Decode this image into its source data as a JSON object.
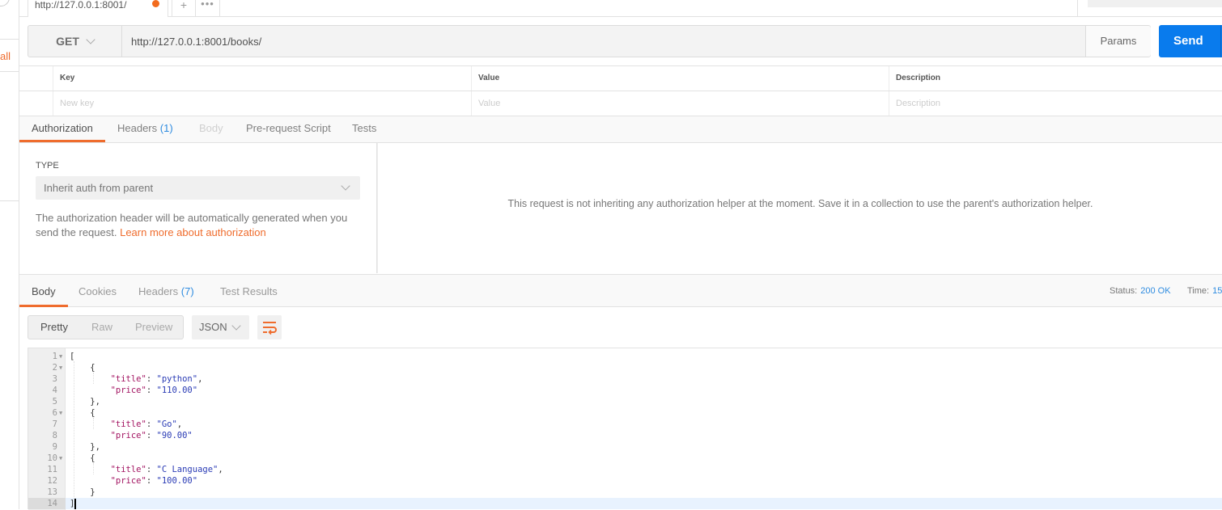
{
  "sidebar": {
    "partial_link": "all"
  },
  "tabs": {
    "active_tab_label": "http://127.0.0.1:8001/",
    "unsaved_indicator": "orange-dot",
    "add_tab": "+",
    "more_tabs": "•••"
  },
  "request": {
    "method": "GET",
    "url": "http://127.0.0.1:8001/books/",
    "params_label": "Params",
    "send_label": "Send"
  },
  "params_table": {
    "headers": [
      "Key",
      "Value",
      "Description"
    ],
    "placeholders": [
      "New key",
      "Value",
      "Description"
    ]
  },
  "request_tabs": [
    {
      "label": "Authorization",
      "state": "active"
    },
    {
      "label": "Headers",
      "count": "(1)",
      "state": "normal"
    },
    {
      "label": "Body",
      "state": "disabled"
    },
    {
      "label": "Pre-request Script",
      "state": "normal"
    },
    {
      "label": "Tests",
      "state": "normal"
    }
  ],
  "auth": {
    "type_label": "TYPE",
    "type_value": "Inherit auth from parent",
    "description": "The authorization header will be automatically generated when you send the request.",
    "learn_more": "Learn more about authorization",
    "message": "This request is not inheriting any authorization helper at the moment. Save it in a collection to use the parent's authorization helper."
  },
  "response_tabs": [
    {
      "label": "Body",
      "state": "active"
    },
    {
      "label": "Cookies",
      "state": "normal"
    },
    {
      "label": "Headers",
      "count": "(7)",
      "state": "normal"
    },
    {
      "label": "Test Results",
      "state": "normal"
    }
  ],
  "response_meta": {
    "status_label": "Status:",
    "status_value": "200 OK",
    "time_label": "Time:",
    "time_value": "15"
  },
  "view_modes": [
    "Pretty",
    "Raw",
    "Preview"
  ],
  "active_view_mode": "Pretty",
  "format": "JSON",
  "wrap_icon": "wrap-lines-icon",
  "colors": {
    "accent": "#ef6c2d",
    "send_button": "#097bed",
    "link_blue": "#2f8ce0",
    "json_key": "#a31562",
    "json_string": "#2a3bb5"
  },
  "response_body": {
    "lines": [
      {
        "n": "1",
        "fold": true,
        "indent": "",
        "parts": [
          [
            "p",
            "["
          ]
        ]
      },
      {
        "n": "2",
        "fold": true,
        "indent": "    ",
        "parts": [
          [
            "p",
            "{"
          ]
        ]
      },
      {
        "n": "3",
        "fold": false,
        "indent": "        ",
        "parts": [
          [
            "k",
            "\"title\""
          ],
          [
            "p",
            ": "
          ],
          [
            "s",
            "\"python\""
          ],
          [
            "p",
            ","
          ]
        ]
      },
      {
        "n": "4",
        "fold": false,
        "indent": "        ",
        "parts": [
          [
            "k",
            "\"price\""
          ],
          [
            "p",
            ": "
          ],
          [
            "s",
            "\"110.00\""
          ]
        ]
      },
      {
        "n": "5",
        "fold": false,
        "indent": "    ",
        "parts": [
          [
            "p",
            "},"
          ]
        ]
      },
      {
        "n": "6",
        "fold": true,
        "indent": "    ",
        "parts": [
          [
            "p",
            "{"
          ]
        ]
      },
      {
        "n": "7",
        "fold": false,
        "indent": "        ",
        "parts": [
          [
            "k",
            "\"title\""
          ],
          [
            "p",
            ": "
          ],
          [
            "s",
            "\"Go\""
          ],
          [
            "p",
            ","
          ]
        ]
      },
      {
        "n": "8",
        "fold": false,
        "indent": "        ",
        "parts": [
          [
            "k",
            "\"price\""
          ],
          [
            "p",
            ": "
          ],
          [
            "s",
            "\"90.00\""
          ]
        ]
      },
      {
        "n": "9",
        "fold": false,
        "indent": "    ",
        "parts": [
          [
            "p",
            "},"
          ]
        ]
      },
      {
        "n": "10",
        "fold": true,
        "indent": "    ",
        "parts": [
          [
            "p",
            "{"
          ]
        ]
      },
      {
        "n": "11",
        "fold": false,
        "indent": "        ",
        "parts": [
          [
            "k",
            "\"title\""
          ],
          [
            "p",
            ": "
          ],
          [
            "s",
            "\"C Language\""
          ],
          [
            "p",
            ","
          ]
        ]
      },
      {
        "n": "12",
        "fold": false,
        "indent": "        ",
        "parts": [
          [
            "k",
            "\"price\""
          ],
          [
            "p",
            ": "
          ],
          [
            "s",
            "\"100.00\""
          ]
        ]
      },
      {
        "n": "13",
        "fold": false,
        "indent": "    ",
        "parts": [
          [
            "p",
            "}"
          ]
        ]
      },
      {
        "n": "14",
        "fold": false,
        "indent": "",
        "parts": [
          [
            "p",
            "]"
          ]
        ],
        "current": true
      }
    ]
  }
}
